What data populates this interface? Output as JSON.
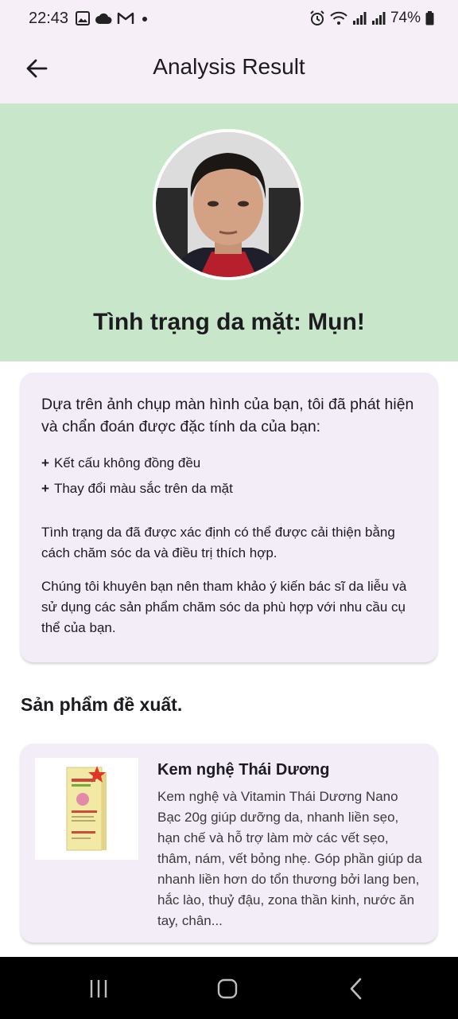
{
  "status_bar": {
    "time": "22:43",
    "battery": "74%",
    "icons_left": [
      "image-icon",
      "cloud-icon",
      "gmail-icon",
      "dot-icon"
    ],
    "icons_right": [
      "alarm-icon",
      "wifi-icon",
      "signal-icon",
      "signal-icon",
      "battery-icon"
    ]
  },
  "app_bar": {
    "title": "Analysis Result",
    "back_icon": "arrow-back-icon"
  },
  "hero": {
    "background_color": "#c8e6c9",
    "headline": "Tình trạng da mặt: Mụn!"
  },
  "analysis": {
    "intro": "Dựa trên ảnh chụp màn hình của bạn, tôi đã phát hiện và chẩn đoán được đặc tính da của bạn:",
    "findings": [
      {
        "marker": "+",
        "text": "Kết cấu không đồng đều"
      },
      {
        "marker": "+",
        "text": "Thay đổi màu sắc trên da mặt"
      }
    ],
    "paragraph_1": "Tình trạng da đã được xác định có thể được cải thiện bằng cách chăm sóc da và điều trị thích hợp.",
    "paragraph_2": "Chúng tôi khuyên bạn nên tham khảo ý kiến bác sĩ da liễu và sử dụng các sản phẩm chăm sóc da phù hợp với nhu cầu cụ thể của bạn."
  },
  "recommendations": {
    "section_title": "Sản phẩm đề xuất.",
    "products": [
      {
        "name": "Kem nghệ Thái Dương",
        "description": "Kem nghệ và Vitamin Thái Dương Nano Bạc 20g giúp dưỡng da, nhanh liền sẹo, hạn chế và hỗ trợ làm mờ các vết sẹo, thâm, nám, vết bỏng nhẹ. Góp phần giúp da nhanh liền hơn do tổn thương bởi lang ben, hắc lào, thuỷ đậu, zona thần kinh, nước ăn tay, chân..."
      }
    ]
  },
  "nav_bar": {
    "icons": [
      "recent-apps-icon",
      "home-icon",
      "back-icon"
    ]
  }
}
